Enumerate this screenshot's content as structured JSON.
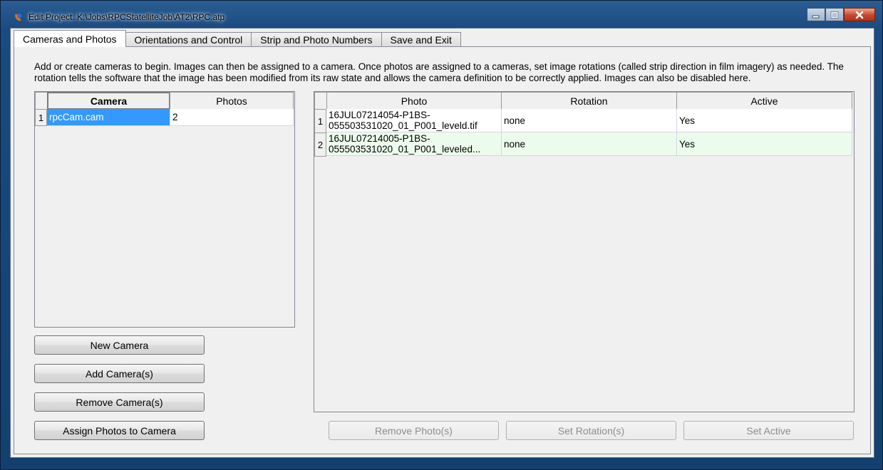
{
  "window": {
    "title": "Edit Project:  K:\\Jobs\\RPCStatelliteJob\\AT2\\RPC.atp"
  },
  "tabs": [
    {
      "label": "Cameras and Photos"
    },
    {
      "label": "Orientations and Control"
    },
    {
      "label": "Strip and Photo Numbers"
    },
    {
      "label": "Save and Exit"
    }
  ],
  "description": "Add or create cameras to begin.  Images can then be assigned to a camera.  Once photos are assigned to a cameras, set image rotations (called strip direction in film imagery) as needed.  The rotation tells the software that the image has been modified from its raw state and allows the camera definition to be correctly applied.  Images can also be disabled here.",
  "camera_grid": {
    "columns": [
      "Camera",
      "Photos"
    ],
    "rows": [
      {
        "num": "1",
        "camera": "rpcCam.cam",
        "photos": "2"
      }
    ]
  },
  "photo_grid": {
    "columns": [
      "Photo",
      "Rotation",
      "Active"
    ],
    "rows": [
      {
        "num": "1",
        "photo": "16JUL07214054-P1BS-055503531020_01_P001_leveld.tif",
        "rotation": "none",
        "active": "Yes"
      },
      {
        "num": "2",
        "photo": "16JUL07214005-P1BS-055503531020_01_P001_leveled...",
        "rotation": "none",
        "active": "Yes"
      }
    ]
  },
  "camera_buttons": {
    "new": "New Camera",
    "add": "Add Camera(s)",
    "remove": "Remove Camera(s)",
    "assign": "Assign Photos to Camera"
  },
  "photo_buttons": {
    "remove": "Remove Photo(s)",
    "rotation": "Set Rotation(s)",
    "active": "Set Active"
  },
  "colors": {
    "selection": "#3399ff",
    "alt_row": "#edfbed"
  }
}
